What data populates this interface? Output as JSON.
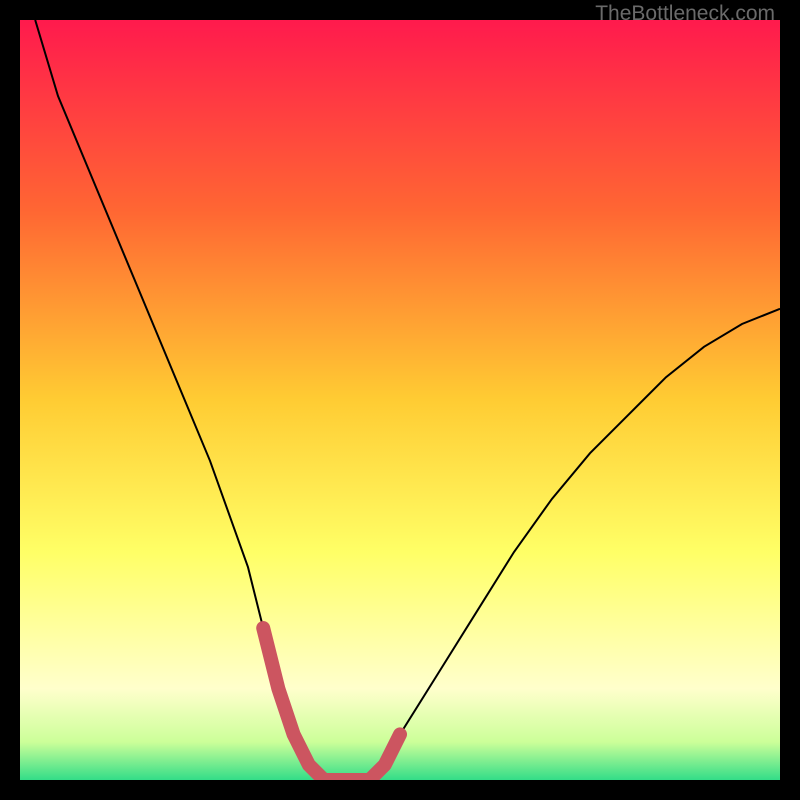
{
  "watermark": "TheBottleneck.com",
  "chart_data": {
    "type": "line",
    "title": "",
    "xlabel": "",
    "ylabel": "",
    "xlim": [
      0,
      100
    ],
    "ylim": [
      0,
      100
    ],
    "background_gradient": {
      "type": "vertical",
      "stops": [
        {
          "pos": 0,
          "color": "#ff1a4d"
        },
        {
          "pos": 25,
          "color": "#ff6633"
        },
        {
          "pos": 50,
          "color": "#ffcc33"
        },
        {
          "pos": 70,
          "color": "#ffff66"
        },
        {
          "pos": 88,
          "color": "#ffffcc"
        },
        {
          "pos": 95,
          "color": "#ccff99"
        },
        {
          "pos": 100,
          "color": "#33dd88"
        }
      ]
    },
    "series": [
      {
        "name": "bottleneck-curve",
        "color": "#000000",
        "width": 2,
        "x": [
          2,
          5,
          10,
          15,
          20,
          25,
          30,
          32,
          34,
          36,
          38,
          40,
          42,
          44,
          46,
          48,
          50,
          55,
          60,
          65,
          70,
          75,
          80,
          85,
          90,
          95,
          100
        ],
        "values": [
          100,
          90,
          78,
          66,
          54,
          42,
          28,
          20,
          12,
          6,
          2,
          0,
          0,
          0,
          0,
          2,
          6,
          14,
          22,
          30,
          37,
          43,
          48,
          53,
          57,
          60,
          62
        ]
      },
      {
        "name": "optimal-zone-marker",
        "color": "#cc5560",
        "width": 10,
        "x": [
          32,
          34,
          36,
          38,
          40,
          42,
          44,
          46,
          48,
          50
        ],
        "values": [
          20,
          12,
          6,
          2,
          0,
          0,
          0,
          0,
          2,
          6
        ]
      }
    ]
  }
}
